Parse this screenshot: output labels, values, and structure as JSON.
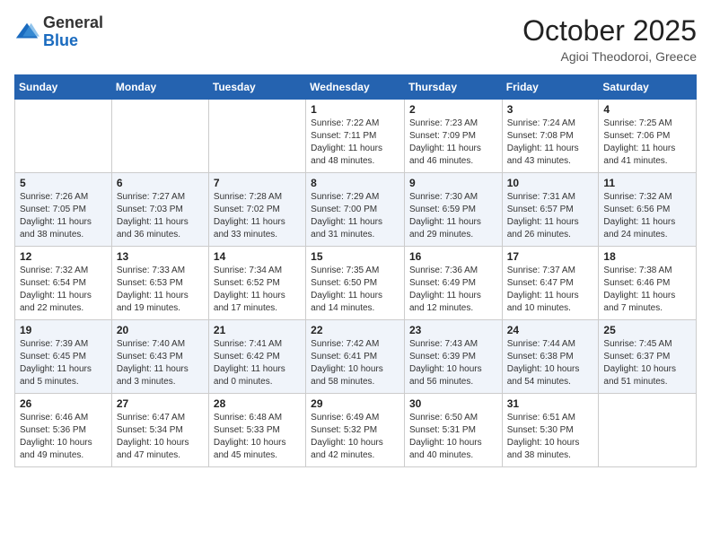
{
  "header": {
    "logo_general": "General",
    "logo_blue": "Blue",
    "month": "October 2025",
    "location": "Agioi Theodoroi, Greece"
  },
  "weekdays": [
    "Sunday",
    "Monday",
    "Tuesday",
    "Wednesday",
    "Thursday",
    "Friday",
    "Saturday"
  ],
  "weeks": [
    [
      {
        "day": "",
        "info": ""
      },
      {
        "day": "",
        "info": ""
      },
      {
        "day": "",
        "info": ""
      },
      {
        "day": "1",
        "info": "Sunrise: 7:22 AM\nSunset: 7:11 PM\nDaylight: 11 hours and 48 minutes."
      },
      {
        "day": "2",
        "info": "Sunrise: 7:23 AM\nSunset: 7:09 PM\nDaylight: 11 hours and 46 minutes."
      },
      {
        "day": "3",
        "info": "Sunrise: 7:24 AM\nSunset: 7:08 PM\nDaylight: 11 hours and 43 minutes."
      },
      {
        "day": "4",
        "info": "Sunrise: 7:25 AM\nSunset: 7:06 PM\nDaylight: 11 hours and 41 minutes."
      }
    ],
    [
      {
        "day": "5",
        "info": "Sunrise: 7:26 AM\nSunset: 7:05 PM\nDaylight: 11 hours and 38 minutes."
      },
      {
        "day": "6",
        "info": "Sunrise: 7:27 AM\nSunset: 7:03 PM\nDaylight: 11 hours and 36 minutes."
      },
      {
        "day": "7",
        "info": "Sunrise: 7:28 AM\nSunset: 7:02 PM\nDaylight: 11 hours and 33 minutes."
      },
      {
        "day": "8",
        "info": "Sunrise: 7:29 AM\nSunset: 7:00 PM\nDaylight: 11 hours and 31 minutes."
      },
      {
        "day": "9",
        "info": "Sunrise: 7:30 AM\nSunset: 6:59 PM\nDaylight: 11 hours and 29 minutes."
      },
      {
        "day": "10",
        "info": "Sunrise: 7:31 AM\nSunset: 6:57 PM\nDaylight: 11 hours and 26 minutes."
      },
      {
        "day": "11",
        "info": "Sunrise: 7:32 AM\nSunset: 6:56 PM\nDaylight: 11 hours and 24 minutes."
      }
    ],
    [
      {
        "day": "12",
        "info": "Sunrise: 7:32 AM\nSunset: 6:54 PM\nDaylight: 11 hours and 22 minutes."
      },
      {
        "day": "13",
        "info": "Sunrise: 7:33 AM\nSunset: 6:53 PM\nDaylight: 11 hours and 19 minutes."
      },
      {
        "day": "14",
        "info": "Sunrise: 7:34 AM\nSunset: 6:52 PM\nDaylight: 11 hours and 17 minutes."
      },
      {
        "day": "15",
        "info": "Sunrise: 7:35 AM\nSunset: 6:50 PM\nDaylight: 11 hours and 14 minutes."
      },
      {
        "day": "16",
        "info": "Sunrise: 7:36 AM\nSunset: 6:49 PM\nDaylight: 11 hours and 12 minutes."
      },
      {
        "day": "17",
        "info": "Sunrise: 7:37 AM\nSunset: 6:47 PM\nDaylight: 11 hours and 10 minutes."
      },
      {
        "day": "18",
        "info": "Sunrise: 7:38 AM\nSunset: 6:46 PM\nDaylight: 11 hours and 7 minutes."
      }
    ],
    [
      {
        "day": "19",
        "info": "Sunrise: 7:39 AM\nSunset: 6:45 PM\nDaylight: 11 hours and 5 minutes."
      },
      {
        "day": "20",
        "info": "Sunrise: 7:40 AM\nSunset: 6:43 PM\nDaylight: 11 hours and 3 minutes."
      },
      {
        "day": "21",
        "info": "Sunrise: 7:41 AM\nSunset: 6:42 PM\nDaylight: 11 hours and 0 minutes."
      },
      {
        "day": "22",
        "info": "Sunrise: 7:42 AM\nSunset: 6:41 PM\nDaylight: 10 hours and 58 minutes."
      },
      {
        "day": "23",
        "info": "Sunrise: 7:43 AM\nSunset: 6:39 PM\nDaylight: 10 hours and 56 minutes."
      },
      {
        "day": "24",
        "info": "Sunrise: 7:44 AM\nSunset: 6:38 PM\nDaylight: 10 hours and 54 minutes."
      },
      {
        "day": "25",
        "info": "Sunrise: 7:45 AM\nSunset: 6:37 PM\nDaylight: 10 hours and 51 minutes."
      }
    ],
    [
      {
        "day": "26",
        "info": "Sunrise: 6:46 AM\nSunset: 5:36 PM\nDaylight: 10 hours and 49 minutes."
      },
      {
        "day": "27",
        "info": "Sunrise: 6:47 AM\nSunset: 5:34 PM\nDaylight: 10 hours and 47 minutes."
      },
      {
        "day": "28",
        "info": "Sunrise: 6:48 AM\nSunset: 5:33 PM\nDaylight: 10 hours and 45 minutes."
      },
      {
        "day": "29",
        "info": "Sunrise: 6:49 AM\nSunset: 5:32 PM\nDaylight: 10 hours and 42 minutes."
      },
      {
        "day": "30",
        "info": "Sunrise: 6:50 AM\nSunset: 5:31 PM\nDaylight: 10 hours and 40 minutes."
      },
      {
        "day": "31",
        "info": "Sunrise: 6:51 AM\nSunset: 5:30 PM\nDaylight: 10 hours and 38 minutes."
      },
      {
        "day": "",
        "info": ""
      }
    ]
  ]
}
